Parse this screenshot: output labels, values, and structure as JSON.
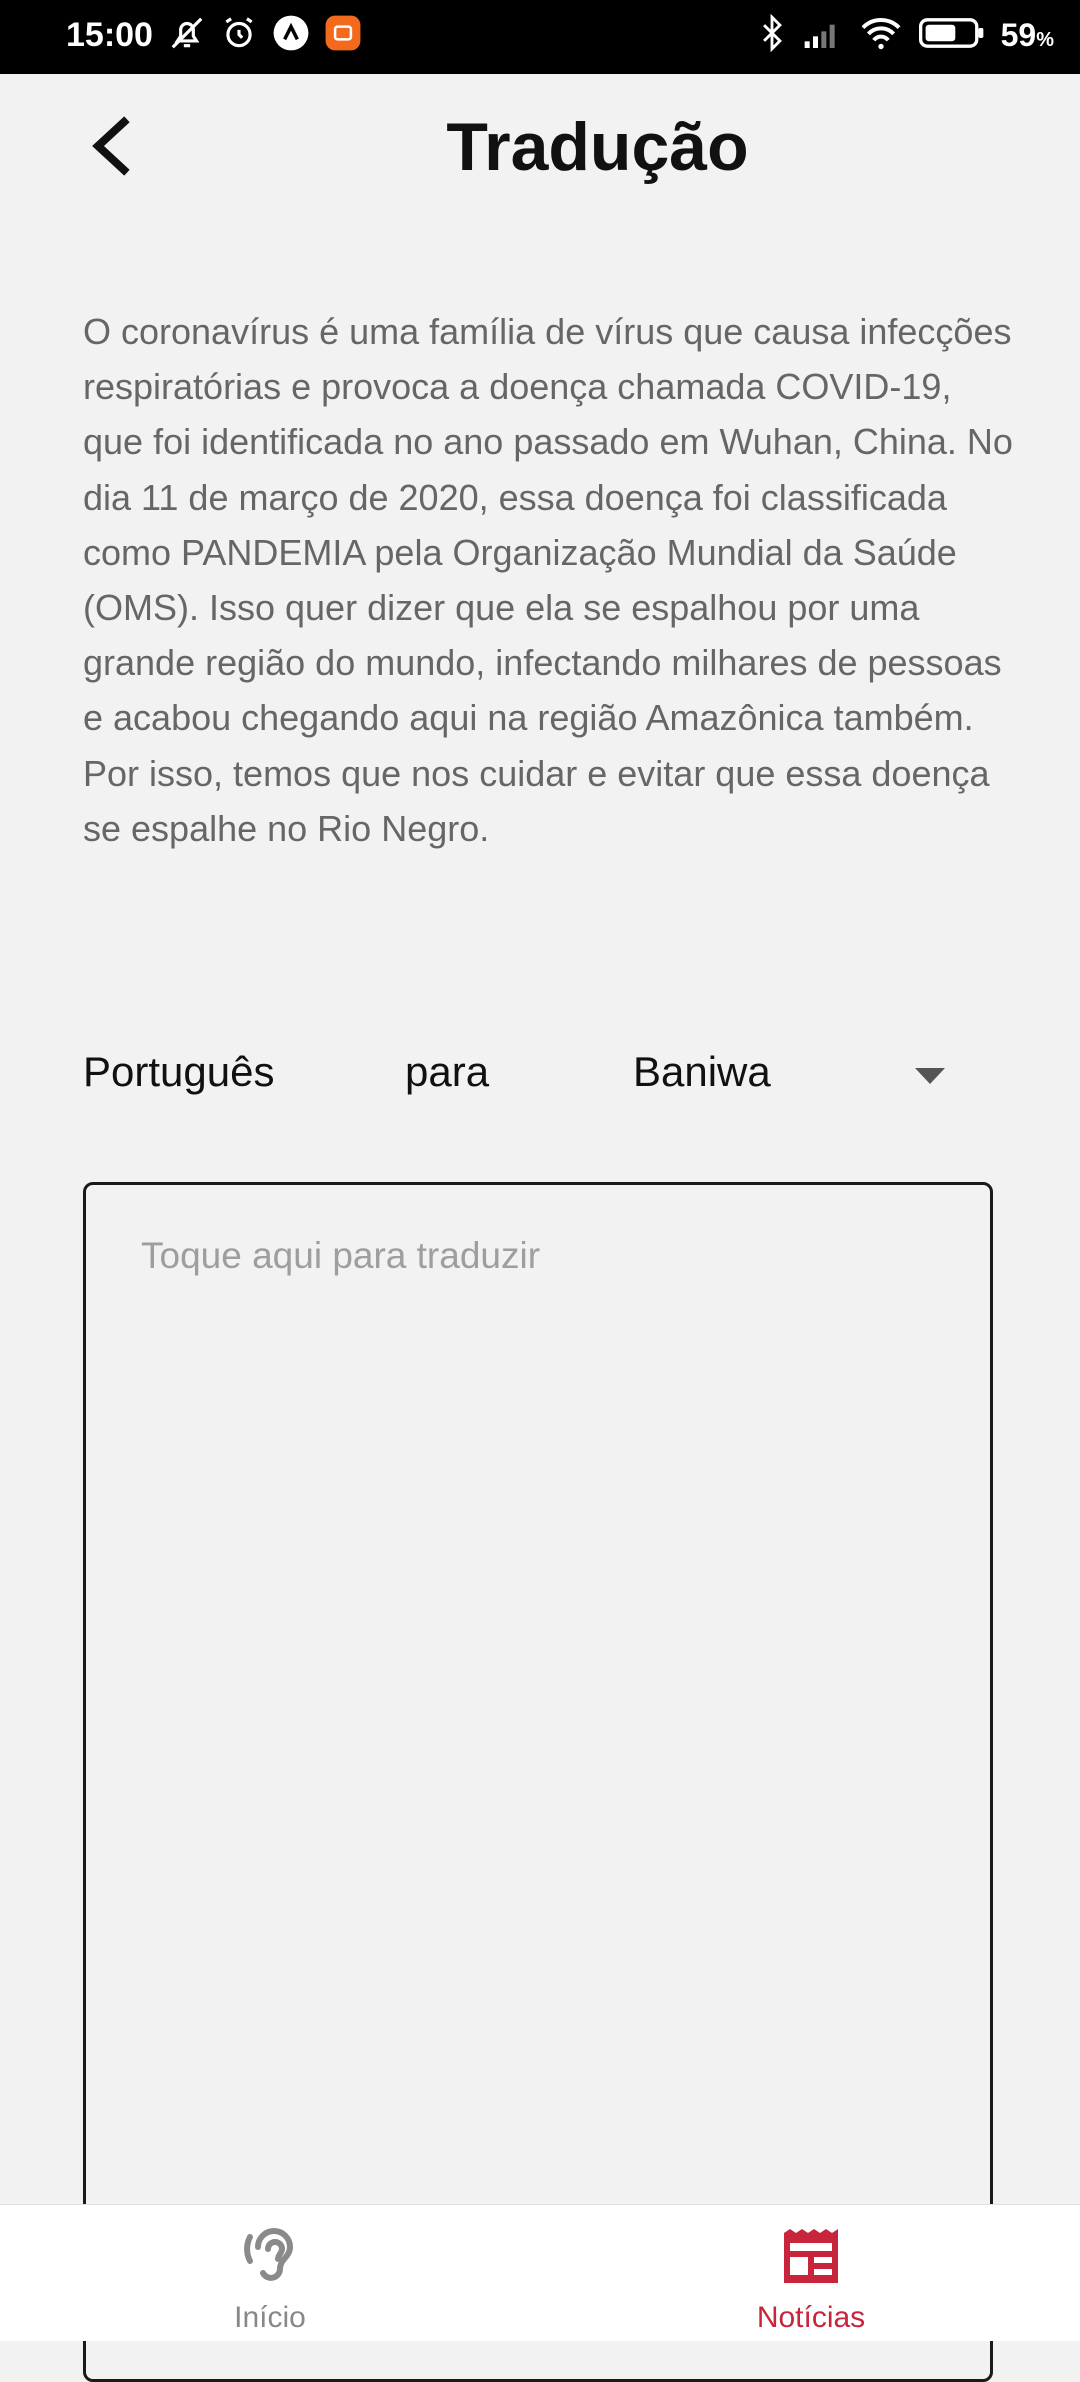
{
  "status_bar": {
    "time": "15:00",
    "battery_percent": "59",
    "battery_unit": "%",
    "icons_left": [
      "bell-off-icon",
      "alarm-icon",
      "app-notification-icon",
      "mi-app-icon"
    ],
    "icons_right": [
      "bluetooth-icon",
      "signal-icon",
      "wifi-icon",
      "battery-icon"
    ]
  },
  "header": {
    "title": "Tradução",
    "back_icon": "chevron-left-icon"
  },
  "article": {
    "text": "O coronavírus é uma família de vírus que causa infecções respiratórias e provoca a doença chamada COVID-19, que foi identificada no ano passado em Wuhan, China. No dia 11 de março de 2020, essa doença foi classificada como PANDEMIA pela Organização Mundial da Saúde (OMS). Isso quer dizer que ela se espalhou por uma grande região do mundo, infectando milhares de pessoas e acabou chegando aqui na região Amazônica também. Por isso, temos que nos cuidar e evitar que essa doença se espalhe no Rio Negro."
  },
  "translation": {
    "source_language": "Português",
    "separator": "para",
    "target_language": "Baniwa",
    "placeholder": "Toque aqui para traduzir"
  },
  "bottom_nav": {
    "items": [
      {
        "label": "Início",
        "icon": "ear-icon",
        "active": false
      },
      {
        "label": "Notícias",
        "icon": "newspaper-icon",
        "active": true
      }
    ]
  },
  "colors": {
    "accent": "#c8243b",
    "background": "#f2f2f2",
    "text_muted": "#666666"
  }
}
